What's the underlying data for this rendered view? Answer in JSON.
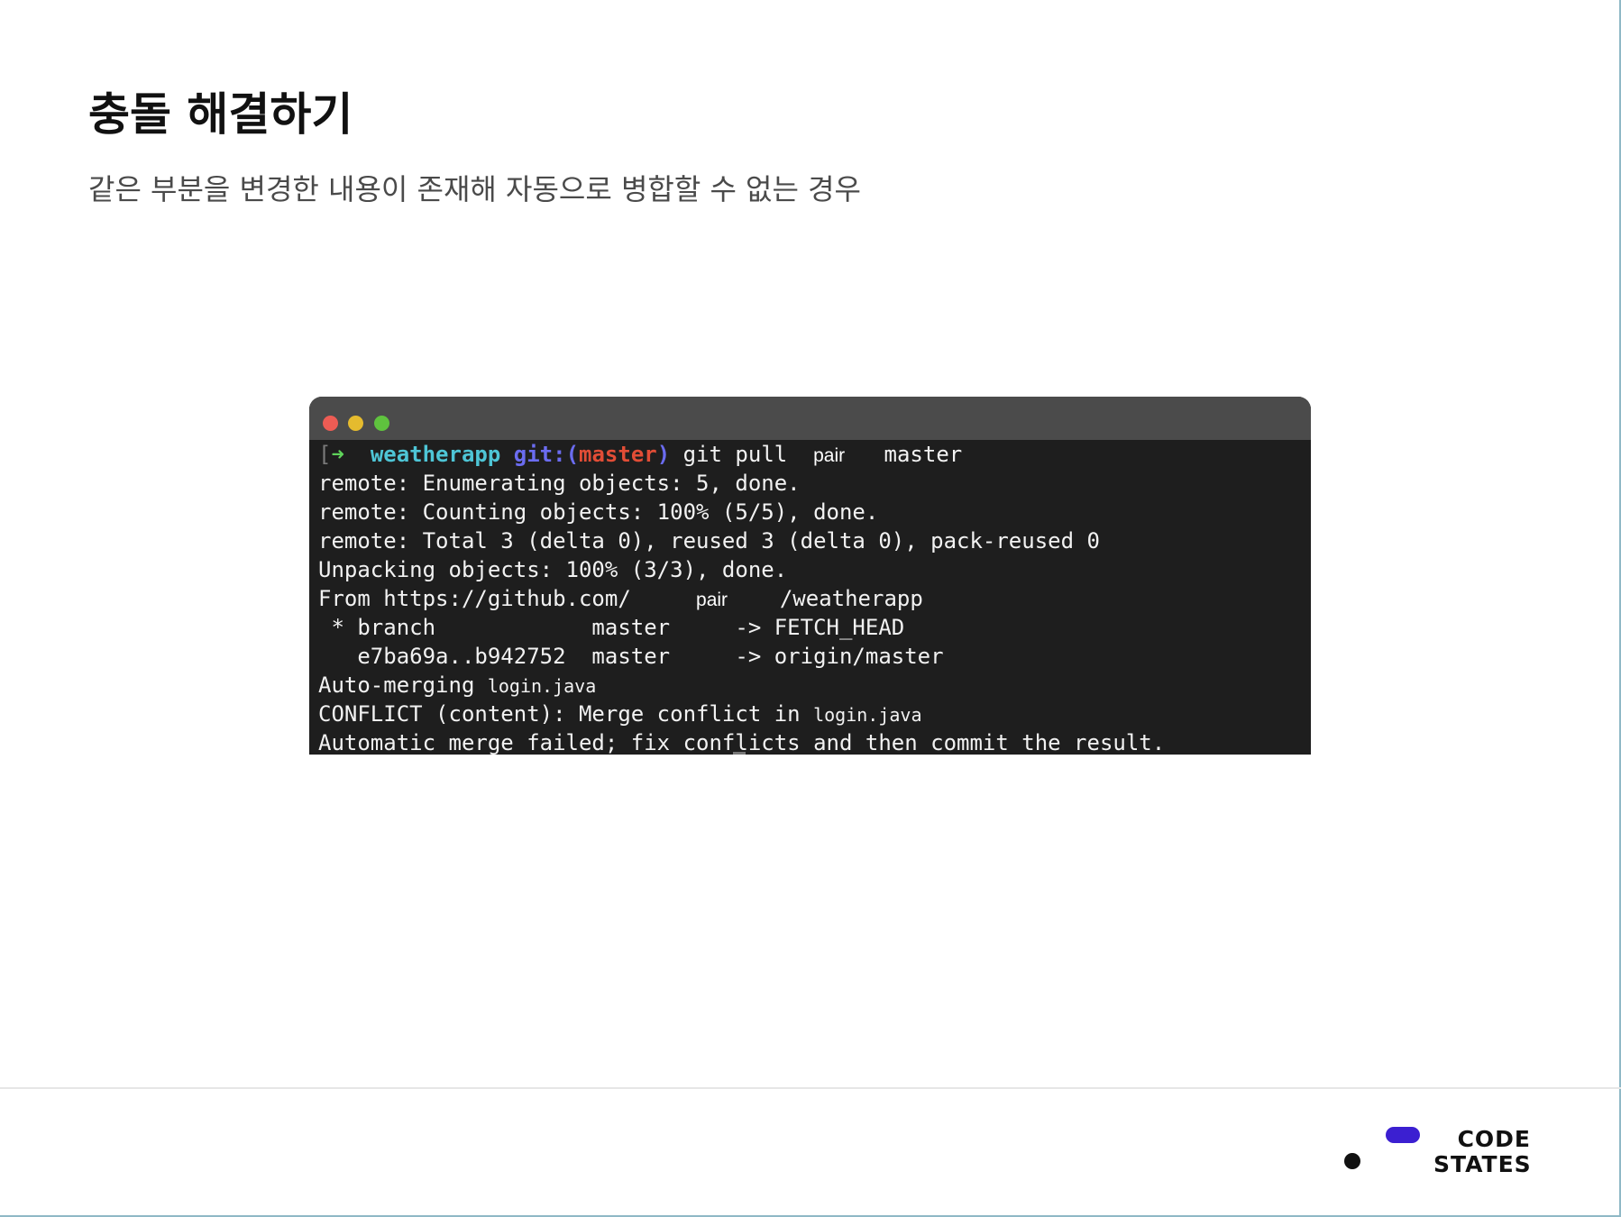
{
  "slide": {
    "title": "충돌 해결하기",
    "subtitle": "같은 부분을 변경한 내용이 존재해 자동으로 병합할 수 없는 경우"
  },
  "terminal": {
    "prompt_bracket": "[",
    "prompt_arrow": "➜",
    "prompt_dir": "weatherapp",
    "prompt_git": "git:(",
    "prompt_branch": "master",
    "prompt_git_close": ")",
    "command": "git pull",
    "command_redacted": "pair",
    "command_branch": "master",
    "lines": [
      "remote: Enumerating objects: 5, done.",
      "remote: Counting objects: 100% (5/5), done.",
      "remote: Total 3 (delta 0), reused 3 (delta 0), pack-reused 0",
      "Unpacking objects: 100% (3/3), done."
    ],
    "from_prefix": "From https://github.com/",
    "from_redacted": "pair",
    "from_suffix": "/weatherapp",
    "branch_line_1": " * branch            master     -> FETCH_HEAD",
    "branch_line_2": "   e7ba69a..b942752  master     -> origin/master",
    "automerge_prefix": "Auto-merging ",
    "automerge_file": "login.java",
    "conflict_prefix": "CONFLICT (content): Merge conflict in ",
    "conflict_file": "login.java",
    "final_line": "Automatic merge failed; fix conflicts and then commit the result."
  },
  "logo": {
    "line1": "CODE",
    "line2": "STATES",
    "accent_color": "#3b1fd1",
    "dark_color": "#111111"
  },
  "colors": {
    "terminal_bg": "#1e1e1e",
    "titlebar_bg": "#4b4b4b",
    "prompt_dir": "#4ec5d6",
    "prompt_git": "#6b6cf0",
    "prompt_branch": "#e24d36"
  }
}
